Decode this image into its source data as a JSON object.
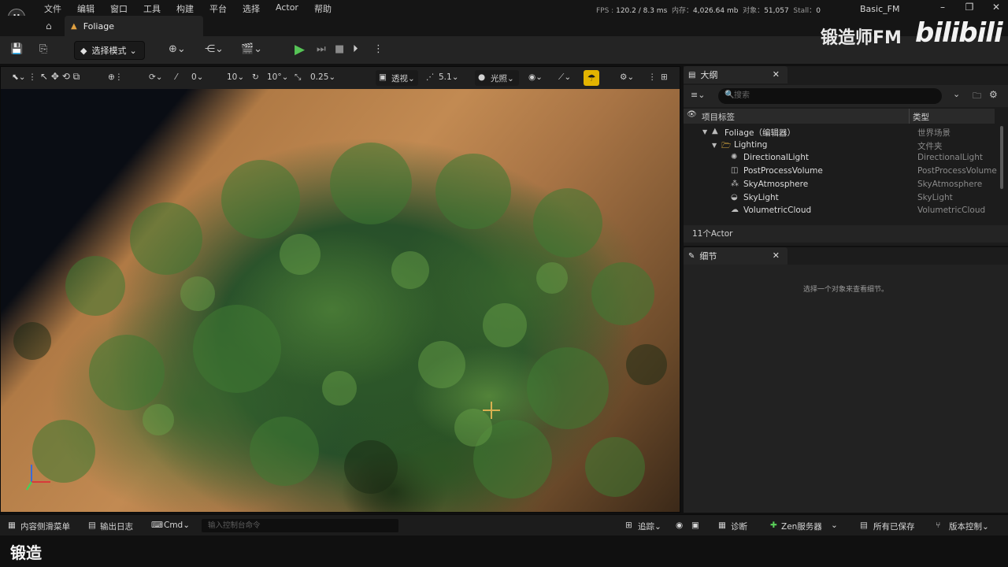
{
  "menubar": {
    "logo": "U",
    "menus": [
      "文件",
      "编辑",
      "窗口",
      "工具",
      "构建",
      "平台",
      "选择",
      "Actor",
      "帮助"
    ],
    "stats": {
      "fps_label": "FPS :",
      "fps": "120.2",
      "ms": "/ 8.3 ms",
      "mem_label": "内存：",
      "mem": "4,026.64 mb",
      "obj_label": "对象：",
      "obj": "51,057",
      "stall_label": "Stall：",
      "stall": "0"
    },
    "project_name": "Basic_FM",
    "window_controls": [
      "–",
      "❐",
      "✕"
    ]
  },
  "tabs": {
    "home_icon": "⌂",
    "level_icon": "▲",
    "level_name": "Foliage"
  },
  "toolbar": {
    "save_icon": "💾",
    "source_icon": "⎘",
    "mode_icon": "◆",
    "mode_label": "选择模式",
    "mode_caret": "⌄",
    "add_icon": "⊕⌄",
    "blueprint_icon": "⋲⌄",
    "cinematic_icon": "🎬⌄",
    "play_icon": "▶",
    "step_icon": "⏭",
    "stop_icon": "■",
    "eject_icon": "⏵",
    "more_icon": "⋮"
  },
  "watermark": {
    "brand": "锻造师FM",
    "platform": "bilibili"
  },
  "viewport_toolbar": {
    "select_tool": "⬉⌄ ⋮",
    "transform_tools": "↖ ✥ ⟲ ⧉",
    "world_icon": "⊕⋮",
    "surface_snap": "⟳⌄",
    "grid_snap_icon": "⁄",
    "grid_snap": "0⌄",
    "grid_value": "10⌄",
    "rot_snap_icon": "↻",
    "rot_value": "10°⌄",
    "scale_snap_icon": "⤡",
    "scale_value": "0.25⌄",
    "camera_icon": "▣",
    "view_mode": "透视⌄",
    "lod_icon": "⋰",
    "lod_value": "5.1⌄",
    "lit_icon": "●",
    "lit_label": "光照⌄",
    "show_icon": "◉⌄",
    "perf_icon": "⟋⌄",
    "rt_icon": "☂",
    "settings_icon": "⚙⌄",
    "more_icon": "⋮",
    "layout_icon": "⊞"
  },
  "outliner": {
    "tab_icon": "▤",
    "title": "大纲",
    "close": "✕",
    "filter_icon": "≡⌄",
    "search_icon": "🔍",
    "search_placeholder": "搜索",
    "search_caret": "⌄",
    "add_folder_icon": "🗀",
    "settings_icon": "⚙",
    "col_eye": "👁",
    "col_label": "项目标签",
    "col_type": "类型",
    "rows": [
      {
        "indent": 1,
        "arrow": "▼",
        "icon": "▲",
        "label": "Foliage（编辑器）",
        "type": "世界场景"
      },
      {
        "indent": 2,
        "arrow": "▼",
        "icon": "🗁",
        "label": "Lighting",
        "type": "文件夹"
      },
      {
        "indent": 3,
        "arrow": "",
        "icon": "✺",
        "label": "DirectionalLight",
        "type": "DirectionalLight"
      },
      {
        "indent": 3,
        "arrow": "",
        "icon": "◫",
        "label": "PostProcessVolume",
        "type": "PostProcessVolume"
      },
      {
        "indent": 3,
        "arrow": "",
        "icon": "⁂",
        "label": "SkyAtmosphere",
        "type": "SkyAtmosphere"
      },
      {
        "indent": 3,
        "arrow": "",
        "icon": "◒",
        "label": "SkyLight",
        "type": "SkyLight"
      },
      {
        "indent": 3,
        "arrow": "",
        "icon": "☁",
        "label": "VolumetricCloud",
        "type": "VolumetricCloud"
      }
    ],
    "actor_count": "11个Actor"
  },
  "details": {
    "tab_icon": "✎",
    "title": "细节",
    "close": "✕",
    "empty_message": "选择一个对象来查看细节。"
  },
  "statusbar": {
    "content_drawer_icon": "▦",
    "content_drawer": "内容侧滑菜单",
    "output_log_icon": "▤",
    "output_log": "输出日志",
    "cmd_icon": "⌨",
    "cmd": "Cmd⌄",
    "console_placeholder": "输入控制台命令",
    "trace_icon": "⊞",
    "trace": "追踪⌄",
    "record_icon": "◉",
    "screenshot_icon": "▣",
    "diagnostics_icon": "▦",
    "diagnostics": "诊断",
    "zen_icon": "✚",
    "zen": "Zen服务器",
    "zen_caret": "⌄",
    "saved_icon": "▤",
    "saved": "所有已保存",
    "vcs_icon": "⑂",
    "vcs": "版本控制⌄"
  },
  "subtitle": "锻造"
}
